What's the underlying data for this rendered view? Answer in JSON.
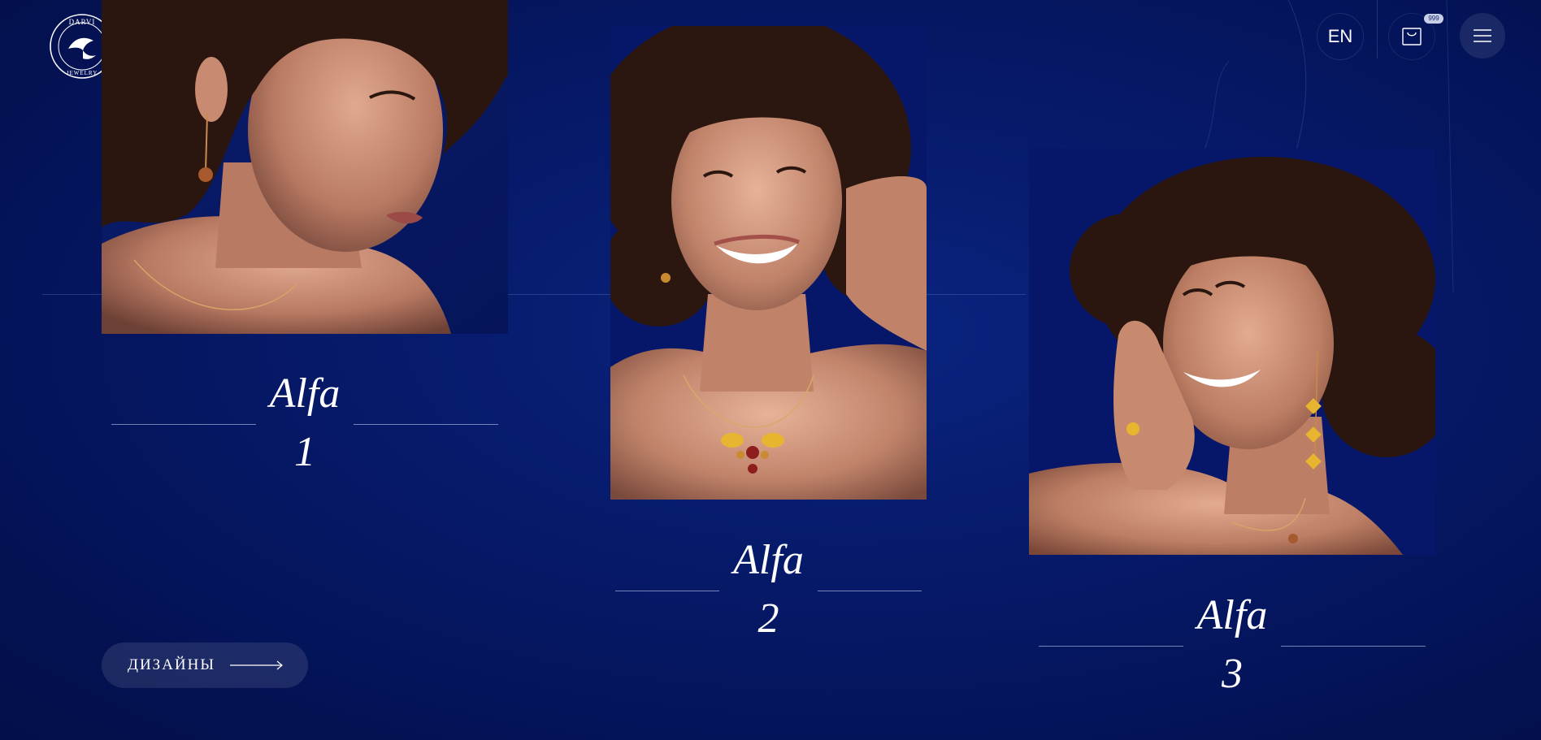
{
  "header": {
    "logo_text": "DARVI JEWELRY",
    "lang_label": "EN",
    "cart_badge": "999"
  },
  "icons": {
    "logo": "bird-logo-icon",
    "cart": "shopping-bag-icon",
    "menu": "hamburger-menu-icon",
    "arrow": "arrow-right-icon"
  },
  "products": [
    {
      "name": "Alfa",
      "number": "1"
    },
    {
      "name": "Alfa",
      "number": "2"
    },
    {
      "name": "Alfa",
      "number": "3"
    }
  ],
  "cta": {
    "designs_label": "ДИЗАЙНЫ"
  },
  "colors": {
    "background": "#061a6a",
    "text": "#ffffff",
    "button_fill": "rgba(255,255,255,0.10)"
  }
}
